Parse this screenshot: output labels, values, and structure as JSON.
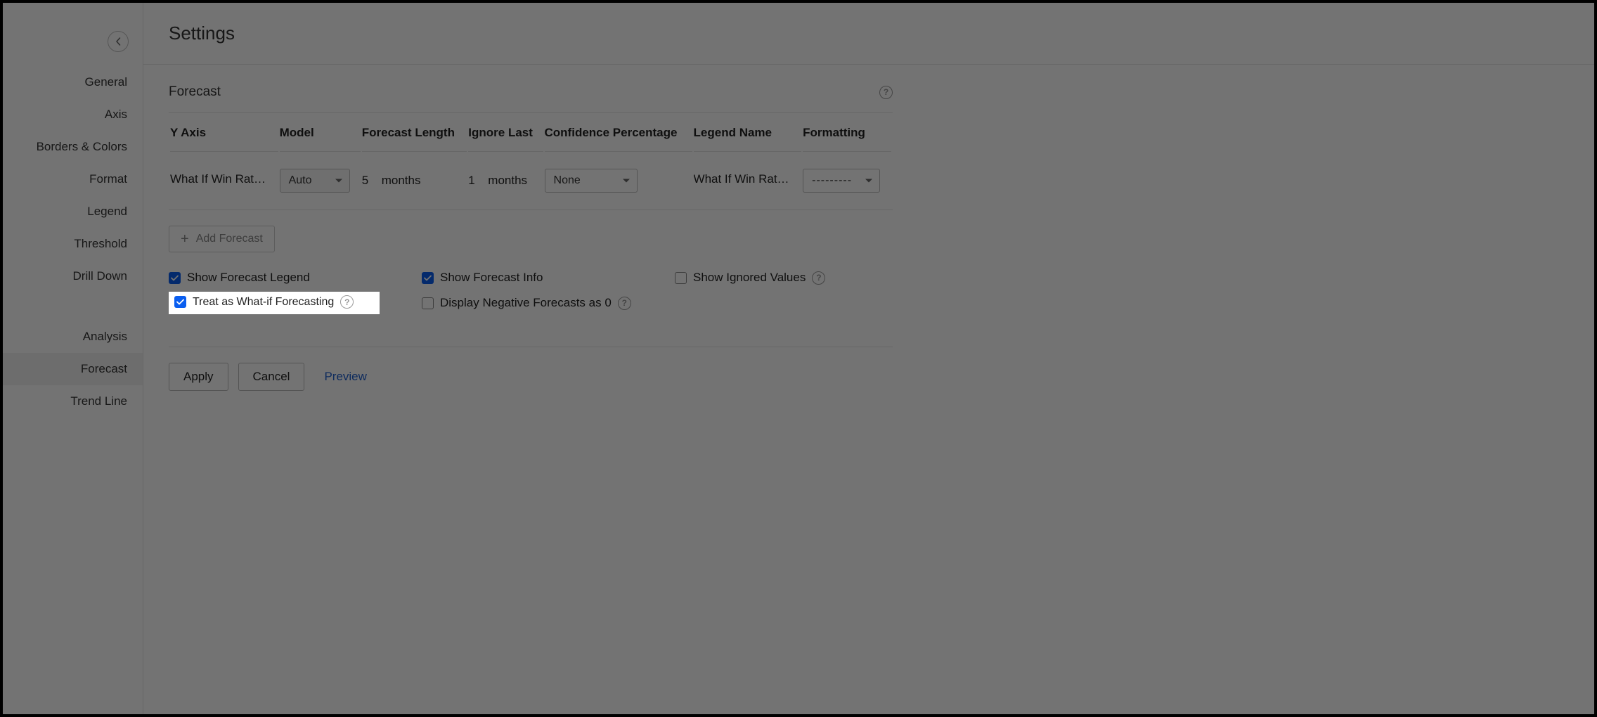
{
  "page": {
    "title": "Settings"
  },
  "sidebar": {
    "items": [
      "General",
      "Axis",
      "Borders & Colors",
      "Format",
      "Legend",
      "Threshold",
      "Drill Down"
    ],
    "analysis_items": [
      "Analysis",
      "Forecast",
      "Trend Line"
    ],
    "active": "Forecast"
  },
  "panel": {
    "section_title": "Forecast",
    "columns": {
      "yaxis": "Y Axis",
      "model": "Model",
      "length": "Forecast Length",
      "ignore": "Ignore Last",
      "confidence": "Confidence Percentage",
      "legend": "Legend Name",
      "formatting": "Formatting"
    },
    "row": {
      "yaxis": "What If Win Rat…",
      "model": "Auto",
      "length_value": "5",
      "length_unit": "months",
      "ignore_value": "1",
      "ignore_unit": "months",
      "confidence": "None",
      "legend": "What If Win Rat…",
      "formatting": "---------"
    },
    "add_forecast": "Add Forecast",
    "options": {
      "show_legend": {
        "label": "Show Forecast Legend",
        "checked": true
      },
      "show_info": {
        "label": "Show Forecast Info",
        "checked": true
      },
      "show_ignored": {
        "label": "Show Ignored Values",
        "checked": false
      },
      "treat_whatif": {
        "label": "Treat as What-if Forecasting",
        "checked": true
      },
      "neg_as_zero": {
        "label": "Display Negative Forecasts as 0",
        "checked": false
      }
    },
    "actions": {
      "apply": "Apply",
      "cancel": "Cancel",
      "preview": "Preview"
    }
  }
}
